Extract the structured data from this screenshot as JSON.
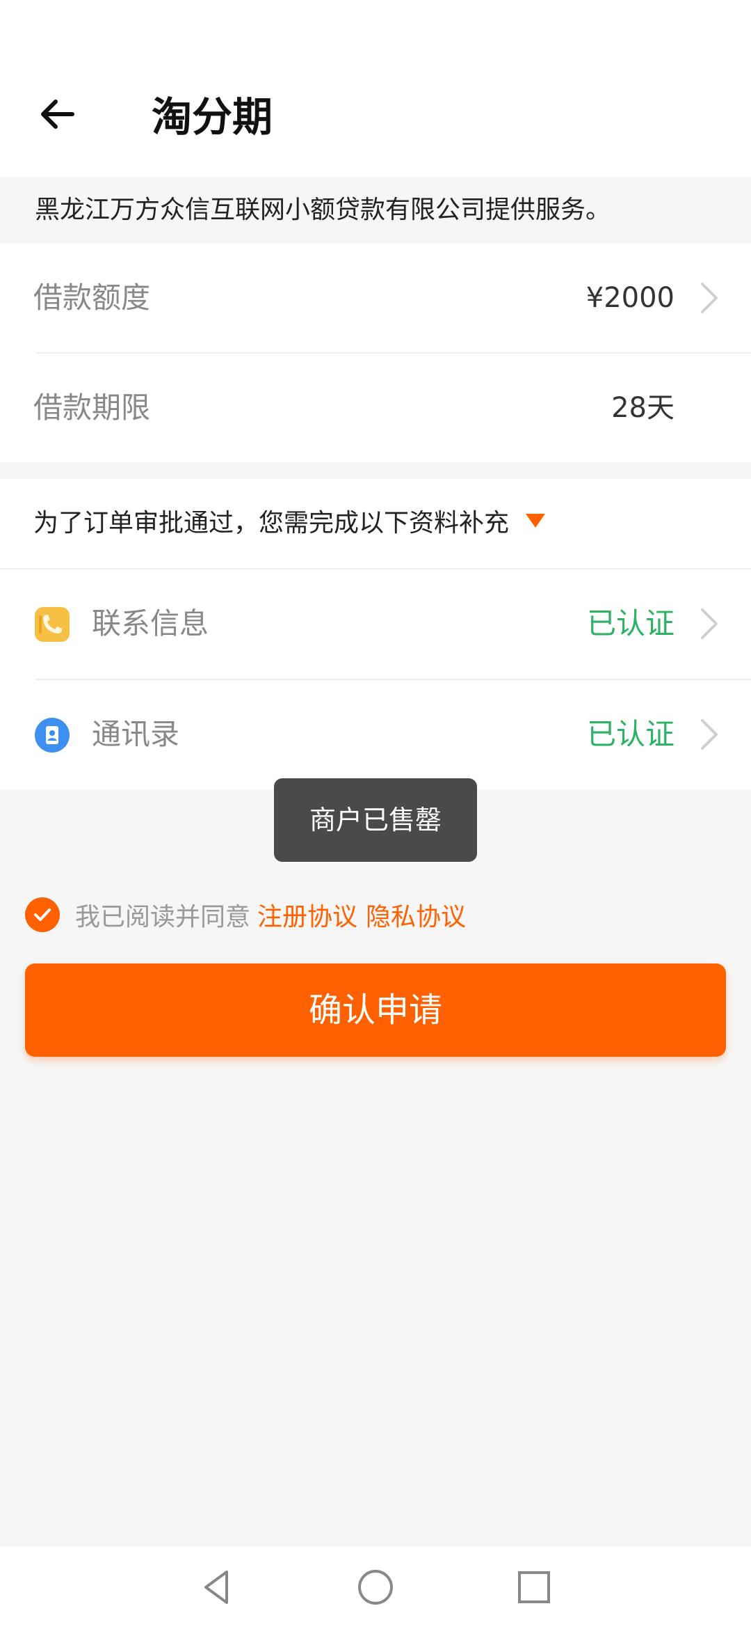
{
  "header": {
    "title": "淘分期"
  },
  "provider_notice": "黑龙江万方众信互联网小额贷款有限公司提供服务。",
  "loan": {
    "amount_label": "借款额度",
    "amount_value": "¥2000",
    "term_label": "借款期限",
    "term_value": "28天"
  },
  "supplement": {
    "header": "为了订单审批通过，您需完成以下资料补充",
    "items": [
      {
        "label": "联系信息",
        "status": "已认证",
        "icon": "phone-icon"
      },
      {
        "label": "通讯录",
        "status": "已认证",
        "icon": "contacts-icon"
      }
    ]
  },
  "toast": "商户已售罄",
  "agreement": {
    "prefix": "我已阅读并同意",
    "link1": "注册协议",
    "link2": "隐私协议",
    "checked": true
  },
  "confirm_label": "确认申请",
  "colors": {
    "accent": "#ff6100",
    "verified": "#2db364",
    "toast_bg": "#4a4a4a"
  },
  "nav_icons": [
    "back-triangle-icon",
    "home-circle-icon",
    "recents-square-icon"
  ]
}
